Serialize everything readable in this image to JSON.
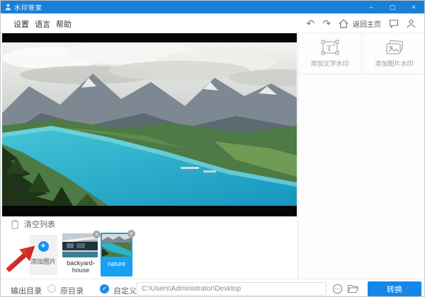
{
  "titlebar": {
    "title": "水印管家",
    "controls": {
      "minimize": "–",
      "maximize": "▢",
      "close": "×"
    }
  },
  "menubar": {
    "items": [
      {
        "label": "设置"
      },
      {
        "label": "语言"
      },
      {
        "label": "帮助"
      }
    ]
  },
  "toolbar": {
    "home_label": "返回主页"
  },
  "icons": {
    "undo": "↶",
    "redo": "↷",
    "plus": "+",
    "close_thumb": "×",
    "check": "✓"
  },
  "watermark_panel": {
    "text_watermark_label": "添加文字水印",
    "image_watermark_label": "添加图片水印"
  },
  "file_list": {
    "clear_label": "清空列表",
    "add_label": "添加图片",
    "items": [
      {
        "name": "backyard-house",
        "selected": false
      },
      {
        "name": "nature",
        "selected": true
      }
    ]
  },
  "output_bar": {
    "label": "输出目录",
    "original_option": "原目录",
    "custom_option": "自定义",
    "custom_selected": true,
    "path_value": "C:\\Users\\Administrator\\Desktop",
    "convert_label": "转换"
  },
  "colors": {
    "titlebar_blue": "#1a7fd6",
    "accent_blue": "#1487e8",
    "selected_thumb_blue": "#18a0f3",
    "annotation_arrow_red": "#c62828"
  }
}
